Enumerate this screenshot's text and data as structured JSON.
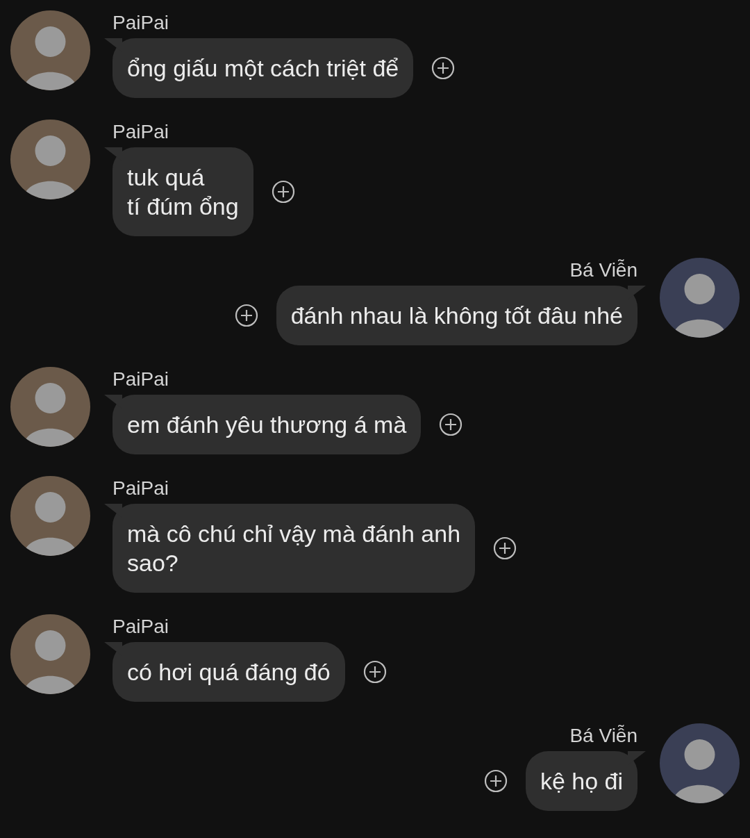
{
  "messages": [
    {
      "kind": "incoming",
      "sender": "PaiPai",
      "text": "ổng giấu một cách triệt để"
    },
    {
      "kind": "incoming",
      "sender": "PaiPai",
      "text": "tuk quá\ntí đúm ổng"
    },
    {
      "kind": "outgoing",
      "sender": "Bá Viễn",
      "text": "đánh nhau là không tốt đâu nhé"
    },
    {
      "kind": "incoming",
      "sender": "PaiPai",
      "text": "em đánh yêu thương á mà"
    },
    {
      "kind": "incoming",
      "sender": "PaiPai",
      "text": "mà cô chú chỉ vậy mà đánh anh\nsao?"
    },
    {
      "kind": "incoming",
      "sender": "PaiPai",
      "text": "có hơi quá đáng đó"
    },
    {
      "kind": "outgoing",
      "sender": "Bá Viễn",
      "text": "kệ họ đi"
    }
  ]
}
